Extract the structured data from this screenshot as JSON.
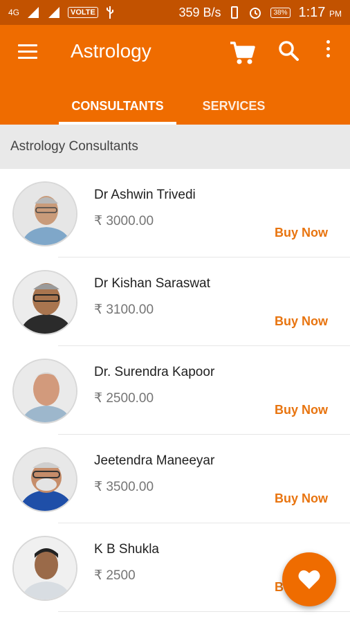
{
  "status_bar": {
    "network_label": "4G",
    "volte": "VOLTE",
    "speed": "359 B/s",
    "battery": "38%",
    "time": "1:17",
    "ampm": "PM"
  },
  "toolbar": {
    "title": "Astrology",
    "icons": [
      "menu-icon",
      "cart-icon",
      "search-icon",
      "more-icon"
    ]
  },
  "tabs": [
    {
      "label": "CONSULTANTS",
      "active": true
    },
    {
      "label": "SERVICES",
      "active": false
    }
  ],
  "section": {
    "title": "Astrology Consultants"
  },
  "consultants": [
    {
      "name": "Dr Ashwin Trivedi",
      "price": "₹ 3000.00",
      "action": "Buy Now"
    },
    {
      "name": "Dr Kishan Saraswat",
      "price": "₹ 3100.00",
      "action": "Buy Now"
    },
    {
      "name": "Dr. Surendra Kapoor",
      "price": "₹ 2500.00",
      "action": "Buy Now"
    },
    {
      "name": "Jeetendra Maneeyar",
      "price": "₹ 3500.00",
      "action": "Buy Now"
    },
    {
      "name": "K B Shukla",
      "price": "₹ 2500",
      "action": "Buy Now"
    }
  ],
  "fab": {
    "icon": "heart-icon"
  },
  "colors": {
    "primary": "#ef6c00",
    "status_bar": "#c25200",
    "accent_text": "#e8740f",
    "section_bg": "#e9e9e9"
  }
}
